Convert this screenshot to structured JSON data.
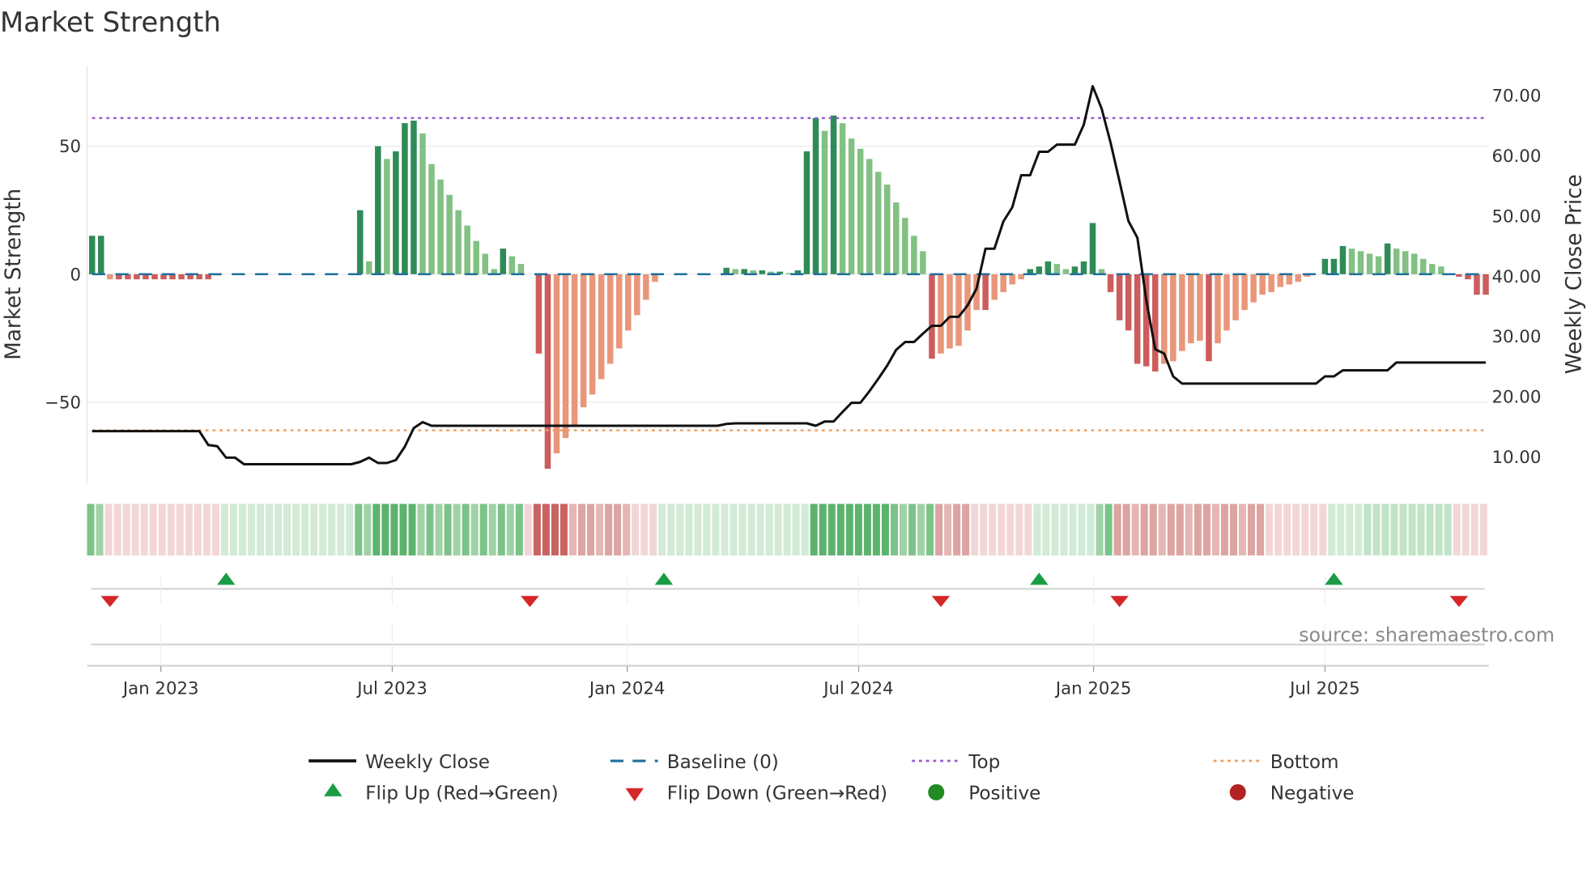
{
  "chart_data": {
    "type": "bar",
    "title": "Market Strength",
    "ylabel": "Market Strength",
    "y2label": "Weekly Close Price",
    "ylim": [
      -82,
      82
    ],
    "y2lim": [
      5,
      75
    ],
    "yticks": [
      {
        "v": 50,
        "label": "50"
      },
      {
        "v": 0,
        "label": "0"
      },
      {
        "v": -50,
        "label": "−50"
      }
    ],
    "y2ticks": [
      {
        "v": 70,
        "label": "70.00"
      },
      {
        "v": 60,
        "label": "60.00"
      },
      {
        "v": 50,
        "label": "50.00"
      },
      {
        "v": 40,
        "label": "40.00"
      },
      {
        "v": 30,
        "label": "30.00"
      },
      {
        "v": 20,
        "label": "20.00"
      },
      {
        "v": 10,
        "label": "10.00"
      }
    ],
    "xticks": [
      {
        "week": 7.7,
        "label": "Jan 2023"
      },
      {
        "week": 33.6,
        "label": "Jul 2023"
      },
      {
        "week": 59.9,
        "label": "Jan 2024"
      },
      {
        "week": 85.8,
        "label": "Jul 2024"
      },
      {
        "week": 112.1,
        "label": "Jan 2025"
      },
      {
        "week": 138.0,
        "label": "Jul 2025"
      }
    ],
    "top_level": 61,
    "bottom_level": -61,
    "baseline": 0,
    "strength": [
      15,
      15,
      -2,
      -2,
      -2,
      -2,
      -2,
      -2,
      -2,
      -2,
      -2,
      -2,
      -2,
      -2,
      -0.5,
      0,
      0,
      0,
      0,
      0,
      0,
      0,
      0,
      0,
      0,
      0,
      0,
      0,
      0,
      0,
      25,
      5,
      50,
      45,
      48,
      59,
      60,
      55,
      43,
      37,
      31,
      25,
      19,
      13,
      8,
      2,
      10,
      7,
      4,
      0,
      -31,
      -76,
      -70,
      -64,
      -59,
      -52,
      -47,
      -41,
      -35,
      -29,
      -22,
      -16,
      -10,
      -3,
      0,
      0,
      0,
      0,
      0,
      0,
      0,
      2.5,
      2,
      2,
      1.5,
      1.5,
      1,
      1,
      0.5,
      1.5,
      48,
      61,
      56,
      62,
      59,
      53,
      49,
      45,
      40,
      35,
      28,
      22,
      15,
      9,
      -33,
      -31,
      -29,
      -28,
      -22,
      -14,
      -14,
      -10,
      -7,
      -4,
      -2,
      2,
      3,
      5,
      4,
      2,
      3,
      5,
      20,
      2,
      -7,
      -18,
      -22,
      -35,
      -36,
      -38,
      -35,
      -34,
      -30,
      -27,
      -26,
      -34,
      -27,
      -22,
      -18,
      -14,
      -11,
      -8,
      -7,
      -5,
      -4,
      -3,
      -1,
      0,
      6,
      6,
      11,
      10,
      9,
      8,
      7,
      12,
      10,
      9,
      8,
      6,
      4,
      3,
      0,
      -1,
      -2,
      -8,
      -8
    ],
    "weekly_close": [
      14.1,
      14.1,
      14.1,
      14.1,
      14.1,
      14.1,
      14.1,
      14.1,
      14.1,
      14.1,
      14.1,
      14.1,
      14.1,
      11.8,
      11.6,
      9.7,
      9.7,
      8.6,
      8.6,
      8.6,
      8.6,
      8.6,
      8.6,
      8.6,
      8.6,
      8.6,
      8.6,
      8.6,
      8.6,
      8.6,
      9.0,
      9.7,
      8.8,
      8.8,
      9.3,
      11.5,
      14.6,
      15.6,
      15.0,
      15,
      15,
      15,
      15,
      15,
      15,
      15,
      15,
      15,
      15,
      15,
      15,
      15,
      15,
      15,
      15,
      15,
      15,
      15,
      15,
      15,
      15,
      15,
      15,
      15,
      15,
      15,
      15,
      15,
      15,
      15,
      15,
      15.3,
      15.4,
      15.4,
      15.4,
      15.4,
      15.4,
      15.4,
      15.4,
      15.4,
      15.4,
      15.0,
      15.7,
      15.7,
      17.3,
      18.8,
      18.8,
      20.7,
      22.8,
      25,
      27.6,
      28.9,
      28.9,
      30.3,
      31.6,
      31.6,
      33.1,
      33.1,
      35,
      37.8,
      44.4,
      44.4,
      48.9,
      51.3,
      56.6,
      56.6,
      60.5,
      60.5,
      61.7,
      61.7,
      61.7,
      65,
      71.4,
      67.7,
      62,
      55.6,
      49,
      46.2,
      35.8,
      27.7,
      27,
      23.2,
      22,
      22,
      22,
      22,
      22,
      22,
      22,
      22,
      22,
      22,
      22,
      22,
      22,
      22,
      22,
      22,
      23.2,
      23.2,
      24.2,
      24.2,
      24.2,
      24.2,
      24.2,
      24.2,
      25.5,
      25.5,
      25.5,
      25.5,
      25.5,
      25.5,
      25.5,
      25.5,
      25.5,
      25.5,
      25.5
    ],
    "state_strip": [
      [
        2,
        2
      ],
      [
        -1,
        13
      ],
      [
        1,
        15
      ],
      [
        2,
        2
      ],
      [
        3,
        5
      ],
      [
        2,
        12
      ],
      [
        -1,
        1
      ],
      [
        -3,
        4
      ],
      [
        -2,
        7
      ],
      [
        -1,
        3
      ],
      [
        1,
        17
      ],
      [
        3,
        9
      ],
      [
        2,
        5
      ],
      [
        -2,
        4
      ],
      [
        -1,
        7
      ],
      [
        1,
        7
      ],
      [
        2,
        2
      ],
      [
        -2,
        17
      ],
      [
        -1,
        7
      ],
      [
        1,
        14
      ],
      [
        -1,
        4
      ]
    ],
    "flip_up_weeks": [
      15,
      64,
      106,
      139
    ],
    "flip_down_weeks": [
      2,
      49,
      95,
      115,
      153
    ],
    "colors": {
      "pos_strong": "#2e8b57",
      "pos_weak": "#82c183",
      "neg_strong": "#cd5c5c",
      "neg_weak": "#e9967a",
      "close": "#111111",
      "baseline": "#1f77b4",
      "top": "#9b59d6",
      "bottom": "#f0a060",
      "flip_up": "#1a9c45",
      "flip_down": "#d62728",
      "positive": "#228b22",
      "negative": "#b22222"
    },
    "legend": {
      "weekly_close": "Weekly Close",
      "baseline": "Baseline (0)",
      "top": "Top",
      "bottom": "Bottom",
      "flip_up": "Flip Up (Red→Green)",
      "flip_down": "Flip Down (Green→Red)",
      "positive": "Positive",
      "negative": "Negative"
    },
    "source": "source: sharemaestro.com"
  }
}
